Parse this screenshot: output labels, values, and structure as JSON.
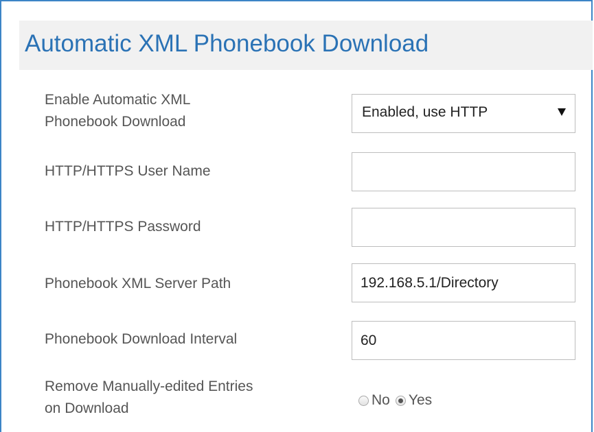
{
  "panel": {
    "title": "Automatic XML Phonebook Download"
  },
  "form": {
    "enable_download": {
      "label_line1": "Enable Automatic XML",
      "label_line2": "Phonebook Download",
      "selected": "Enabled, use HTTP"
    },
    "username": {
      "label": "HTTP/HTTPS User Name",
      "value": ""
    },
    "password": {
      "label": "HTTP/HTTPS Password",
      "value": ""
    },
    "server_path": {
      "label": "Phonebook XML Server Path",
      "value": "192.168.5.1/Directory"
    },
    "interval": {
      "label": "Phonebook Download Interval",
      "value": "60"
    },
    "remove_entries": {
      "label_line1": "Remove Manually-edited Entries",
      "label_line2": "on Download",
      "option_no": "No",
      "option_yes": "Yes",
      "selected": "Yes"
    }
  },
  "colors": {
    "title": "#2a72b5",
    "frame_border": "#3c84c6",
    "header_background": "#f1f1f1",
    "label_text": "#555555"
  }
}
